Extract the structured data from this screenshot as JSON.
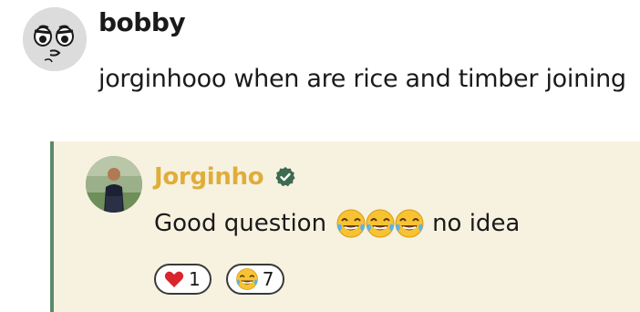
{
  "messages": {
    "parent": {
      "author": "bobby",
      "text": "jorginhooo when are rice and timber joining",
      "avatar_icon": "cartoon-face-icon"
    },
    "reply": {
      "author": "Jorginho",
      "author_color": "#e0ad3a",
      "verified_icon": "verified-check-icon",
      "text_before": "Good question",
      "emojis": [
        "face-with-tears-of-joy-icon",
        "face-with-tears-of-joy-icon",
        "face-with-tears-of-joy-icon"
      ],
      "text_after": "no idea",
      "reactions": [
        {
          "icon": "red-heart-icon",
          "count": "1"
        },
        {
          "icon": "face-with-tears-of-joy-icon",
          "count": "7"
        }
      ]
    }
  },
  "colors": {
    "reply_background": "#f7f2e0",
    "reply_border": "#5b8a6a"
  }
}
